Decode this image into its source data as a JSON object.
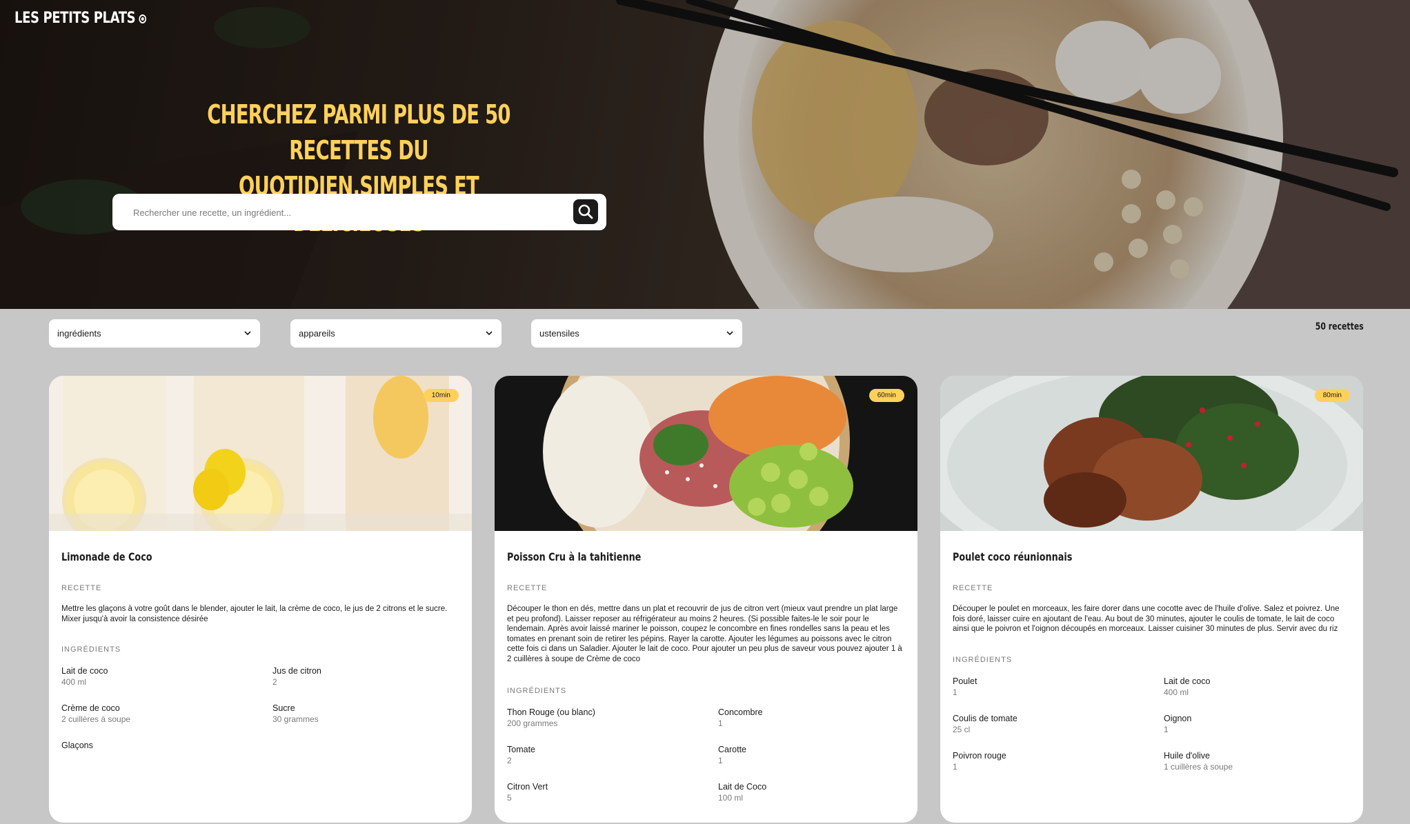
{
  "header": {
    "logo": "LES PETITS PLATS",
    "headline_line1": "Cherchez parmi plus de 50 recettes du",
    "headline_line2": "quotidien,simples et délicieuses"
  },
  "search": {
    "placeholder": "Rechercher une recette, un ingrédient...",
    "icon": "search-icon"
  },
  "filters": [
    {
      "label": "ingrédients"
    },
    {
      "label": "appareils"
    },
    {
      "label": "ustensiles"
    }
  ],
  "recipe_count": "50 recettes",
  "labels": {
    "recipe": "RECETTE",
    "ingredients": "INGRÉDIENTS"
  },
  "recipes": [
    {
      "title": "Limonade de Coco",
      "time": "10min",
      "description": "Mettre les glaçons à votre goût dans le blender, ajouter le lait, la crème de coco, le jus de 2 citrons et le sucre. Mixer jusqu'à avoir la consistence désirée",
      "ingredients": [
        {
          "name": "Lait de coco",
          "quantity": "400 ml"
        },
        {
          "name": "Jus de citron",
          "quantity": "2"
        },
        {
          "name": "Crème de coco",
          "quantity": "2 cuillères à soupe"
        },
        {
          "name": "Sucre",
          "quantity": "30 grammes"
        },
        {
          "name": "Glaçons",
          "quantity": ""
        }
      ]
    },
    {
      "title": "Poisson Cru à la tahitienne",
      "time": "60min",
      "description": "Découper le thon en dés, mettre dans un plat et recouvrir de jus de citron vert (mieux vaut prendre un plat large et peu profond). Laisser reposer au réfrigérateur au moins 2 heures. (Si possible faites-le le soir pour le lendemain. Après avoir laissé mariner le poisson, coupez le concombre en fines rondelles sans la peau et les tomates en prenant soin de retirer les pépins. Rayer la carotte. Ajouter les légumes au poissons avec le citron cette fois ci dans un Saladier. Ajouter le lait de coco. Pour ajouter un peu plus de saveur vous pouvez ajouter 1 à 2 cuillères à soupe de Crème de coco",
      "ingredients": [
        {
          "name": "Thon Rouge (ou blanc)",
          "quantity": "200 grammes"
        },
        {
          "name": "Concombre",
          "quantity": "1"
        },
        {
          "name": "Tomate",
          "quantity": "2"
        },
        {
          "name": "Carotte",
          "quantity": "1"
        },
        {
          "name": "Citron Vert",
          "quantity": "5"
        },
        {
          "name": "Lait de Coco",
          "quantity": "100 ml"
        }
      ]
    },
    {
      "title": "Poulet coco réunionnais",
      "time": "80min",
      "description": "Découper le poulet en morceaux, les faire dorer dans une cocotte avec de l'huile d'olive. Salez et poivrez. Une fois doré, laisser cuire en ajoutant de l'eau. Au bout de 30 minutes, ajouter le coulis de tomate, le lait de coco ainsi que le poivron et l'oignon découpés en morceaux. Laisser cuisiner 30 minutes de plus. Servir avec du riz",
      "ingredients": [
        {
          "name": "Poulet",
          "quantity": "1"
        },
        {
          "name": "Lait de coco",
          "quantity": "400 ml"
        },
        {
          "name": "Coulis de tomate",
          "quantity": "25 cl"
        },
        {
          "name": "Oignon",
          "quantity": "1"
        },
        {
          "name": "Poivron rouge",
          "quantity": "1"
        },
        {
          "name": "Huile d'olive",
          "quantity": "1 cuillères à soupe"
        }
      ]
    }
  ],
  "colors": {
    "accent": "#ffd15b",
    "background": "#c7c7c7",
    "text": "#1b1b1b",
    "muted": "#7a7a7a"
  }
}
